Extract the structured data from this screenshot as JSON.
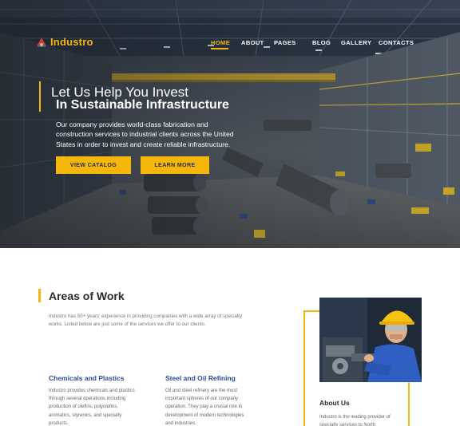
{
  "brand": {
    "name": "Industro",
    "accent": "#f5b70b",
    "link_blue": "#2c4a9a"
  },
  "nav": {
    "items": [
      {
        "label": "HOME",
        "active": true
      },
      {
        "label": "ABOUT",
        "active": false
      },
      {
        "label": "PAGES",
        "active": false
      },
      {
        "label": "BLOG",
        "active": false
      },
      {
        "label": "GALLERY",
        "active": false
      },
      {
        "label": "CONTACTS",
        "active": false
      }
    ]
  },
  "hero": {
    "title_line1": "Let Us Help You Invest",
    "title_line2": "In Sustainable Infrastructure",
    "description": "Our company provides world-class fabrication and construction services to industrial clients across the United States in order to invest and create reliable infrastructure.",
    "buttons": {
      "catalog": "VIEW CATALOG",
      "learn": "LEARN MORE"
    },
    "background_icon": "factory-interior-image"
  },
  "areas": {
    "title": "Areas of Work",
    "description": "Industro has 50+ years' experience in providing companies with a wide array of specialty works. Listed below are just some of the services we offer to our clients.",
    "cards": [
      {
        "title": "Chemicals and Plastics",
        "text": "Industro provides chemicals and plastics through several operations including production of olefins, polyolefins, aromatics, styrenics, and specialty products."
      },
      {
        "title": "Steel and Oil Refining",
        "text": "Oil and steel refinery are the most important spheres of our company operation. They play a crucial role in development of modern technologies and industries."
      }
    ]
  },
  "about": {
    "title": "About Us",
    "description": "Industro is the leading provider of specialty services to North",
    "photo_icon": "worker-at-machine-image"
  }
}
